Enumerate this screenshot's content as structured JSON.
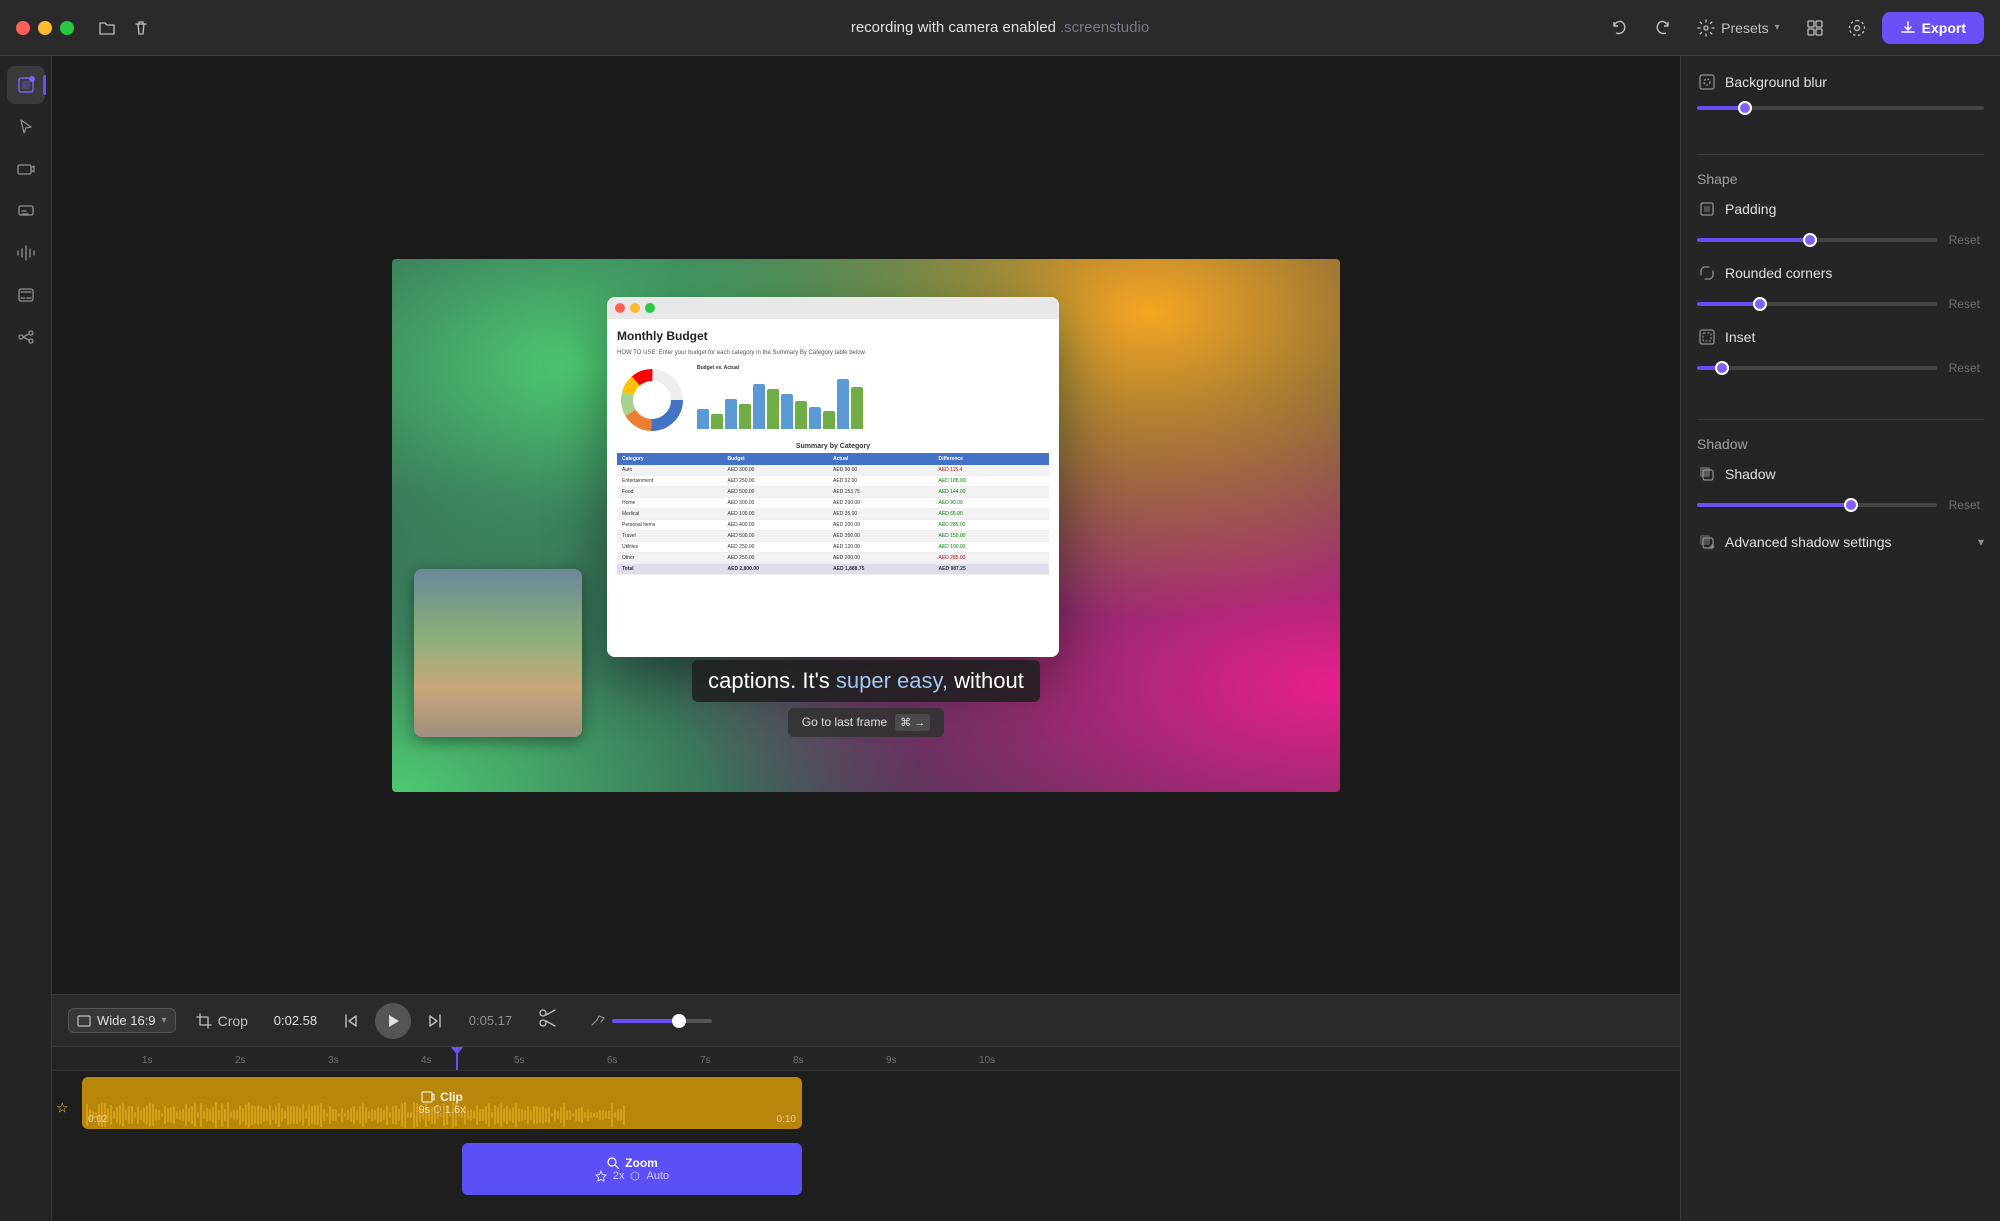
{
  "titlebar": {
    "title_main": "recording with camera enabled",
    "title_ext": ".screenstudio",
    "undo_label": "Undo",
    "redo_label": "Redo",
    "presets_label": "Presets",
    "layout_label": "Layout",
    "settings_label": "Settings",
    "export_label": "Export"
  },
  "toolbar": {
    "items": [
      {
        "id": "select",
        "icon": "⊹",
        "label": "Select"
      },
      {
        "id": "cursor",
        "icon": "↖",
        "label": "Cursor"
      },
      {
        "id": "camera",
        "icon": "📷",
        "label": "Camera"
      },
      {
        "id": "caption",
        "icon": "💬",
        "label": "Caption"
      },
      {
        "id": "audio",
        "icon": "🔊",
        "label": "Audio"
      },
      {
        "id": "shortcut",
        "icon": "⌘",
        "label": "Shortcut"
      },
      {
        "id": "connect",
        "icon": "⚙",
        "label": "Connect"
      }
    ]
  },
  "preview": {
    "caption_text": "captions. It's super easy, without",
    "caption_highlight_start": "super easy,",
    "go_to_frame_label": "Go to last frame",
    "go_to_frame_kbd": "⌘ →"
  },
  "transport": {
    "aspect_ratio": "Wide 16:9",
    "crop_label": "Crop",
    "current_time": "0:02.58",
    "end_time": "0:05.17",
    "skip_start_icon": "⏮",
    "play_icon": "▶",
    "skip_end_icon": "⏭"
  },
  "timeline": {
    "ruler_marks": [
      "1s",
      "2s",
      "3s",
      "4s",
      "5s",
      "6s",
      "7s",
      "8s",
      "9s",
      "10s"
    ],
    "playhead_position_pct": 43,
    "clip": {
      "icon": "🎬",
      "label": "Clip",
      "duration": "9s",
      "speed": "1.6x",
      "time_start": "0:02",
      "time_end": "0:10"
    },
    "zoom_clip": {
      "icon": "🔍",
      "label": "Zoom",
      "multiplier": "2x",
      "mode": "Auto"
    }
  },
  "right_panel": {
    "background_blur_label": "Background blur",
    "background_blur_value": 15,
    "shape_section": "Shape",
    "padding_label": "Padding",
    "padding_value": 47,
    "padding_reset": "Reset",
    "rounded_corners_label": "Rounded corners",
    "rounded_corners_value": 25,
    "rounded_corners_reset": "Reset",
    "inset_label": "Inset",
    "inset_value": 8,
    "inset_reset": "Reset",
    "shadow_section": "Shadow",
    "shadow_label": "Shadow",
    "shadow_value": 65,
    "shadow_reset": "Reset",
    "advanced_shadow_label": "Advanced shadow settings",
    "chevron": "▾"
  }
}
